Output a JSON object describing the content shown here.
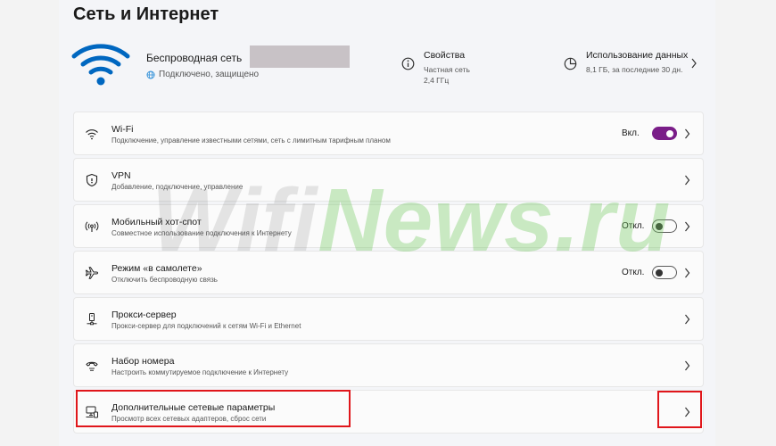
{
  "page_title": "Сеть и Интернет",
  "network": {
    "name": "Беспроводная сеть",
    "status": "Подключено, защищено"
  },
  "properties": {
    "title": "Свойства",
    "line1": "Частная сеть",
    "line2": "2,4 ГГц"
  },
  "data_usage": {
    "title": "Использование данных",
    "sub": "8,1 ГБ, за последние 30 дн."
  },
  "items": [
    {
      "title": "Wi-Fi",
      "sub": "Подключение, управление известными сетями, сеть с лимитным тарифным планом",
      "state": "Вкл.",
      "toggle": "on",
      "icon": "wifi-icon"
    },
    {
      "title": "VPN",
      "sub": "Добавление, подключение, управление",
      "state": "",
      "toggle": "",
      "icon": "shield-icon"
    },
    {
      "title": "Мобильный хот-спот",
      "sub": "Совместное использование подключения к Интернету",
      "state": "Откл.",
      "toggle": "off",
      "icon": "hotspot-icon"
    },
    {
      "title": "Режим «в самолете»",
      "sub": "Отключить беспроводную связь",
      "state": "Откл.",
      "toggle": "off",
      "icon": "airplane-icon"
    },
    {
      "title": "Прокси-сервер",
      "sub": "Прокси-сервер для подключений к сетям Wi-Fi и Ethernet",
      "state": "",
      "toggle": "",
      "icon": "proxy-icon"
    },
    {
      "title": "Набор номера",
      "sub": "Настроить коммутируемое подключение к Интернету",
      "state": "",
      "toggle": "",
      "icon": "dialup-icon"
    },
    {
      "title": "Дополнительные сетевые параметры",
      "sub": "Просмотр всех сетевых адаптеров, сброс сети",
      "state": "",
      "toggle": "",
      "icon": "network-adapter-icon"
    }
  ],
  "watermark": {
    "part1": "Wifi",
    "part2": "News",
    "part3": ".ru"
  },
  "colors": {
    "accent": "#7a1d88",
    "wifi_blue": "#0067c0",
    "highlight": "#e0161b"
  }
}
